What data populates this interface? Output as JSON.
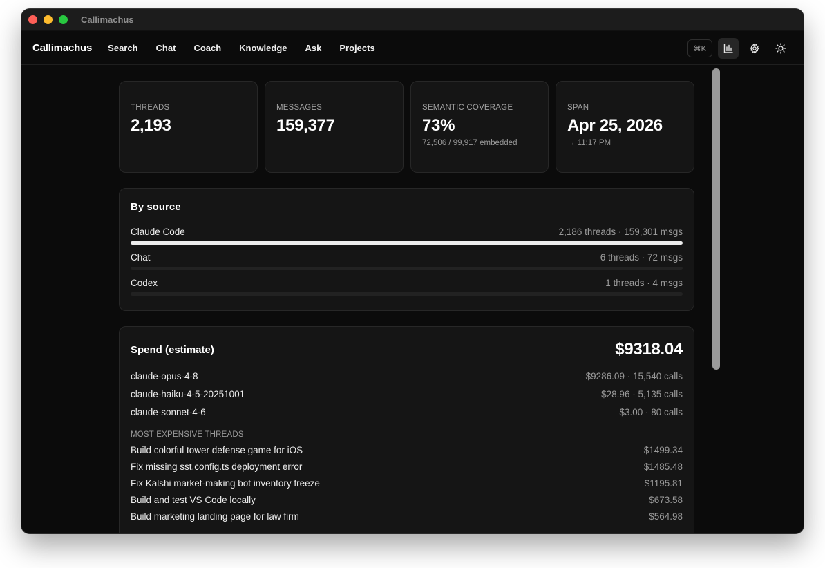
{
  "window": {
    "title": "Callimachus"
  },
  "nav": {
    "brand": "Callimachus",
    "links": [
      "Search",
      "Chat",
      "Coach",
      "Knowledge",
      "Ask",
      "Projects"
    ],
    "shortcut": "⌘K"
  },
  "stats": [
    {
      "label": "THREADS",
      "value": "2,193",
      "sub": ""
    },
    {
      "label": "MESSAGES",
      "value": "159,377",
      "sub": ""
    },
    {
      "label": "SEMANTIC COVERAGE",
      "value": "73%",
      "sub": "72,506 / 99,917 embedded"
    },
    {
      "label": "SPAN",
      "value": "Apr 25, 2026",
      "sub": "→ 11:17 PM"
    }
  ],
  "by_source": {
    "title": "By source",
    "items": [
      {
        "name": "Claude Code",
        "meta": "2,186 threads · 159,301 msgs",
        "fraction": 0.9995
      },
      {
        "name": "Chat",
        "meta": "6 threads · 72 msgs",
        "fraction": 0.0005
      },
      {
        "name": "Codex",
        "meta": "1 threads · 4 msgs",
        "fraction": 3e-05
      }
    ]
  },
  "spend": {
    "title": "Spend (estimate)",
    "total": "$9318.04",
    "models": [
      {
        "name": "claude-opus-4-8",
        "meta": "$9286.09 · 15,540 calls"
      },
      {
        "name": "claude-haiku-4-5-20251001",
        "meta": "$28.96 · 5,135 calls"
      },
      {
        "name": "claude-sonnet-4-6",
        "meta": "$3.00 · 80 calls"
      }
    ],
    "threads_heading": "MOST EXPENSIVE THREADS",
    "threads": [
      {
        "name": "Build colorful tower defense game for iOS",
        "cost": "$1499.34"
      },
      {
        "name": "Fix missing sst.config.ts deployment error",
        "cost": "$1485.48"
      },
      {
        "name": "Fix Kalshi market-making bot inventory freeze",
        "cost": "$1195.81"
      },
      {
        "name": "Build and test VS Code locally",
        "cost": "$673.58"
      },
      {
        "name": "Build marketing landing page for law firm",
        "cost": "$564.98"
      }
    ]
  },
  "icons": {
    "stats": "bar-chart-icon",
    "settings": "gear-icon",
    "theme": "sun-icon"
  }
}
